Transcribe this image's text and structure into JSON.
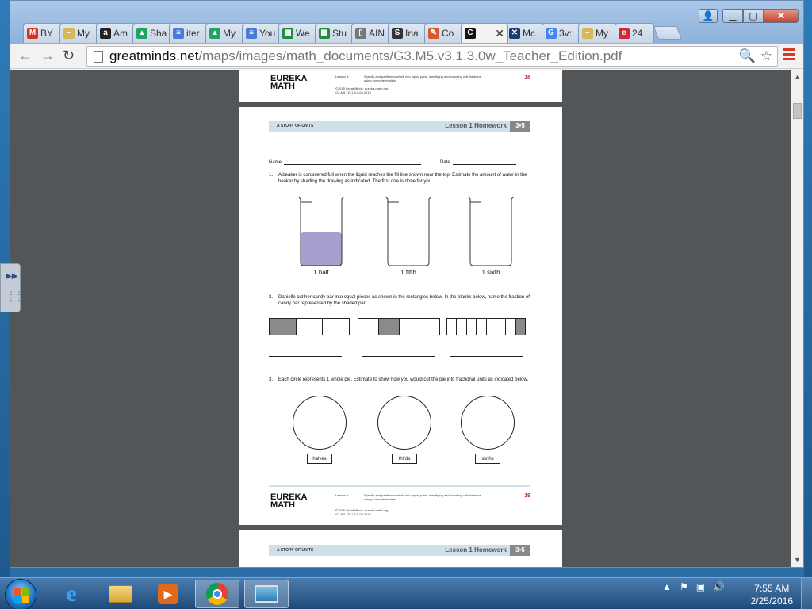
{
  "browser": {
    "tabs": [
      {
        "label": "BY",
        "fav": "M",
        "color": "#d93025",
        "active": false
      },
      {
        "label": "My",
        "fav": "~",
        "color": "#d6b85a",
        "active": false
      },
      {
        "label": "Am",
        "fav": "a",
        "color": "#222222",
        "active": false
      },
      {
        "label": "Sha",
        "fav": "▲",
        "color": "#1fa463",
        "active": false
      },
      {
        "label": "iter",
        "fav": "≡",
        "color": "#4a7bd6",
        "active": false
      },
      {
        "label": "My",
        "fav": "▲",
        "color": "#1fa463",
        "active": false
      },
      {
        "label": "You",
        "fav": "≡",
        "color": "#4a7bd6",
        "active": false
      },
      {
        "label": "We",
        "fav": "▦",
        "color": "#1e8e3e",
        "active": false
      },
      {
        "label": "Stu",
        "fav": "▦",
        "color": "#1e8e3e",
        "active": false
      },
      {
        "label": "AIN",
        "fav": "▯",
        "color": "#777777",
        "active": false
      },
      {
        "label": "Ina",
        "fav": "S",
        "color": "#333333",
        "active": false
      },
      {
        "label": "Co",
        "fav": "✎",
        "color": "#d85a2a",
        "active": false
      },
      {
        "label": "",
        "fav": "C",
        "color": "#111111",
        "active": true
      },
      {
        "label": "Mc",
        "fav": "✕",
        "color": "#1c3c6e",
        "active": false
      },
      {
        "label": "3v:",
        "fav": "G",
        "color": "#4285f4",
        "active": false
      },
      {
        "label": "My",
        "fav": "~",
        "color": "#d6b85a",
        "active": false
      },
      {
        "label": "24",
        "fav": "e",
        "color": "#cc2a36",
        "active": false
      }
    ],
    "url_host": "greatminds.net",
    "url_path": "/maps/images/math_documents/G3.M5.v3.1.3.0w_Teacher_Edition.pdf"
  },
  "pdf": {
    "prev_footer": {
      "logo_line1": "EUREKA",
      "logo_line2": "MATH",
      "lesson_tag": "Lesson 1:",
      "lesson_desc": "Specify and partition a whole into equal parts, identifying and counting unit fractions using concrete models.",
      "copyright": "©2015 Great Minds. eureka-math.org",
      "code": "G3-M5-TE-1.3.0-06.2015",
      "page_number": "18"
    },
    "header": {
      "story": "A STORY OF UNITS",
      "lesson": "Lesson 1 Homework",
      "grade": "3•5"
    },
    "name_label": "Name",
    "date_label": "Date",
    "q1": {
      "number": "1.",
      "text": "A beaker is considered full when the liquid reaches the fill line shown near the top. Estimate the amount of water in the beaker by shading the drawing as indicated. The first one is done for you.",
      "beakers": [
        {
          "label": "1 half",
          "fill": 0.5
        },
        {
          "label": "1 fifth",
          "fill": 0
        },
        {
          "label": "1 sixth",
          "fill": 0
        }
      ],
      "fill_color": "#a89fcf"
    },
    "q2": {
      "number": "2.",
      "text": "Danielle cut her candy bar into equal pieces as shown in the rectangles below. In the blanks below, name the fraction of candy bar represented by the shaded part.",
      "bars": [
        {
          "pieces": 3,
          "shaded_index": 0
        },
        {
          "pieces": 4,
          "shaded_index": 1
        },
        {
          "pieces": 8,
          "shaded_index": 7
        }
      ]
    },
    "q3": {
      "number": "3.",
      "text": "Each circle represents 1 whole pie. Estimate to show how you would cut the pie into fractional units as indicated below.",
      "circles": [
        {
          "label": "halves"
        },
        {
          "label": "thirds"
        },
        {
          "label": "sixths"
        }
      ]
    },
    "footer": {
      "logo_line1": "EUREKA",
      "logo_line2": "MATH",
      "lesson_tag": "Lesson 1:",
      "lesson_desc": "Specify and partition a whole into equal parts, identifying and counting unit fractions using concrete models.",
      "copyright": "©2015 Great Minds. eureka-math.org",
      "code": "G3-M5-TE-1.3.0-06.2015",
      "page_number": "19"
    },
    "next_header": {
      "story": "A STORY OF UNITS",
      "lesson": "Lesson 1 Homework",
      "grade": "3•5"
    }
  },
  "taskbar": {
    "time": "7:55 AM",
    "date": "2/25/2016",
    "apps": [
      "internet-explorer",
      "file-explorer",
      "media-player",
      "chrome",
      "photo-viewer"
    ]
  }
}
